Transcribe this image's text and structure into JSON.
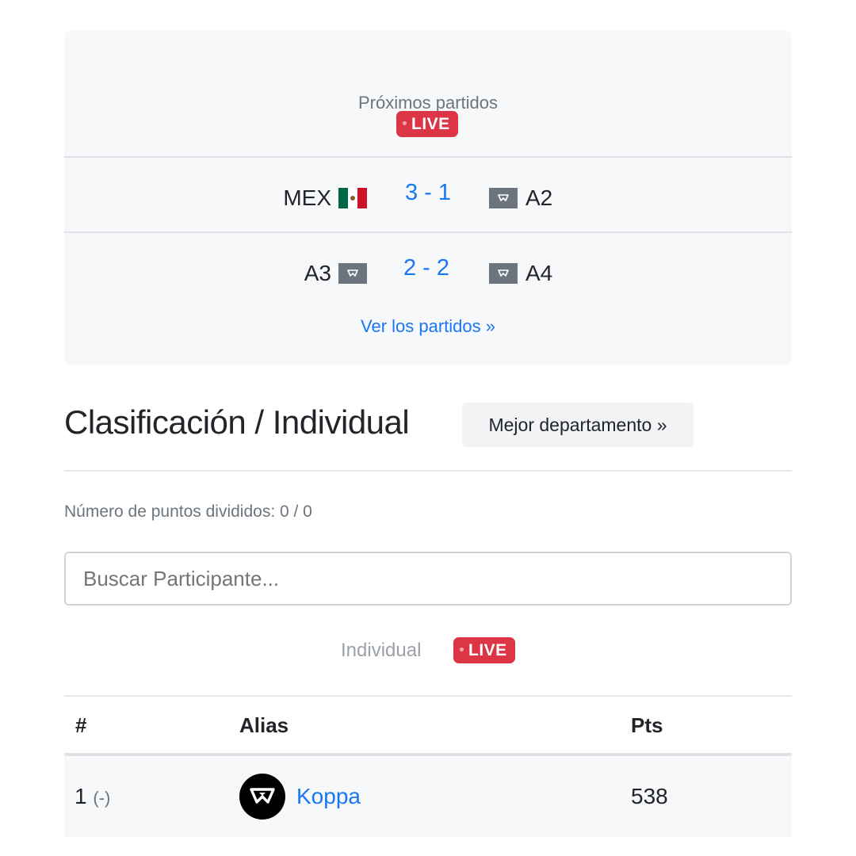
{
  "upcoming": {
    "title": "Próximos partidos",
    "live_label": "LIVE",
    "matches": [
      {
        "home": "MEX",
        "home_flag": "mexico-flag",
        "score": "3 - 1",
        "away": "A2",
        "away_flag": "generic-team-flag"
      },
      {
        "home": "A3",
        "home_flag": "generic-team-flag",
        "score": "2 - 2",
        "away": "A4",
        "away_flag": "generic-team-flag"
      }
    ],
    "see_all_link": "Ver los partidos »"
  },
  "standings": {
    "heading": "Clasificación / Individual",
    "best_department_button": "Mejor departamento »",
    "points_divided": "Número de puntos divididos: 0 / 0",
    "search_placeholder": "Buscar Participante...",
    "tab_label": "Individual",
    "live_label": "LIVE",
    "columns": [
      "#",
      "Alias",
      "Pts"
    ],
    "rows": [
      {
        "rank": "1",
        "change": "(-)",
        "alias": "Koppa",
        "avatar": "team-logo-avatar",
        "points": "538"
      }
    ]
  },
  "colors": {
    "accent_blue": "#1877f2",
    "live_red": "#dc3545",
    "muted_text": "#6c757d",
    "card_bg": "#f7f8f9"
  }
}
